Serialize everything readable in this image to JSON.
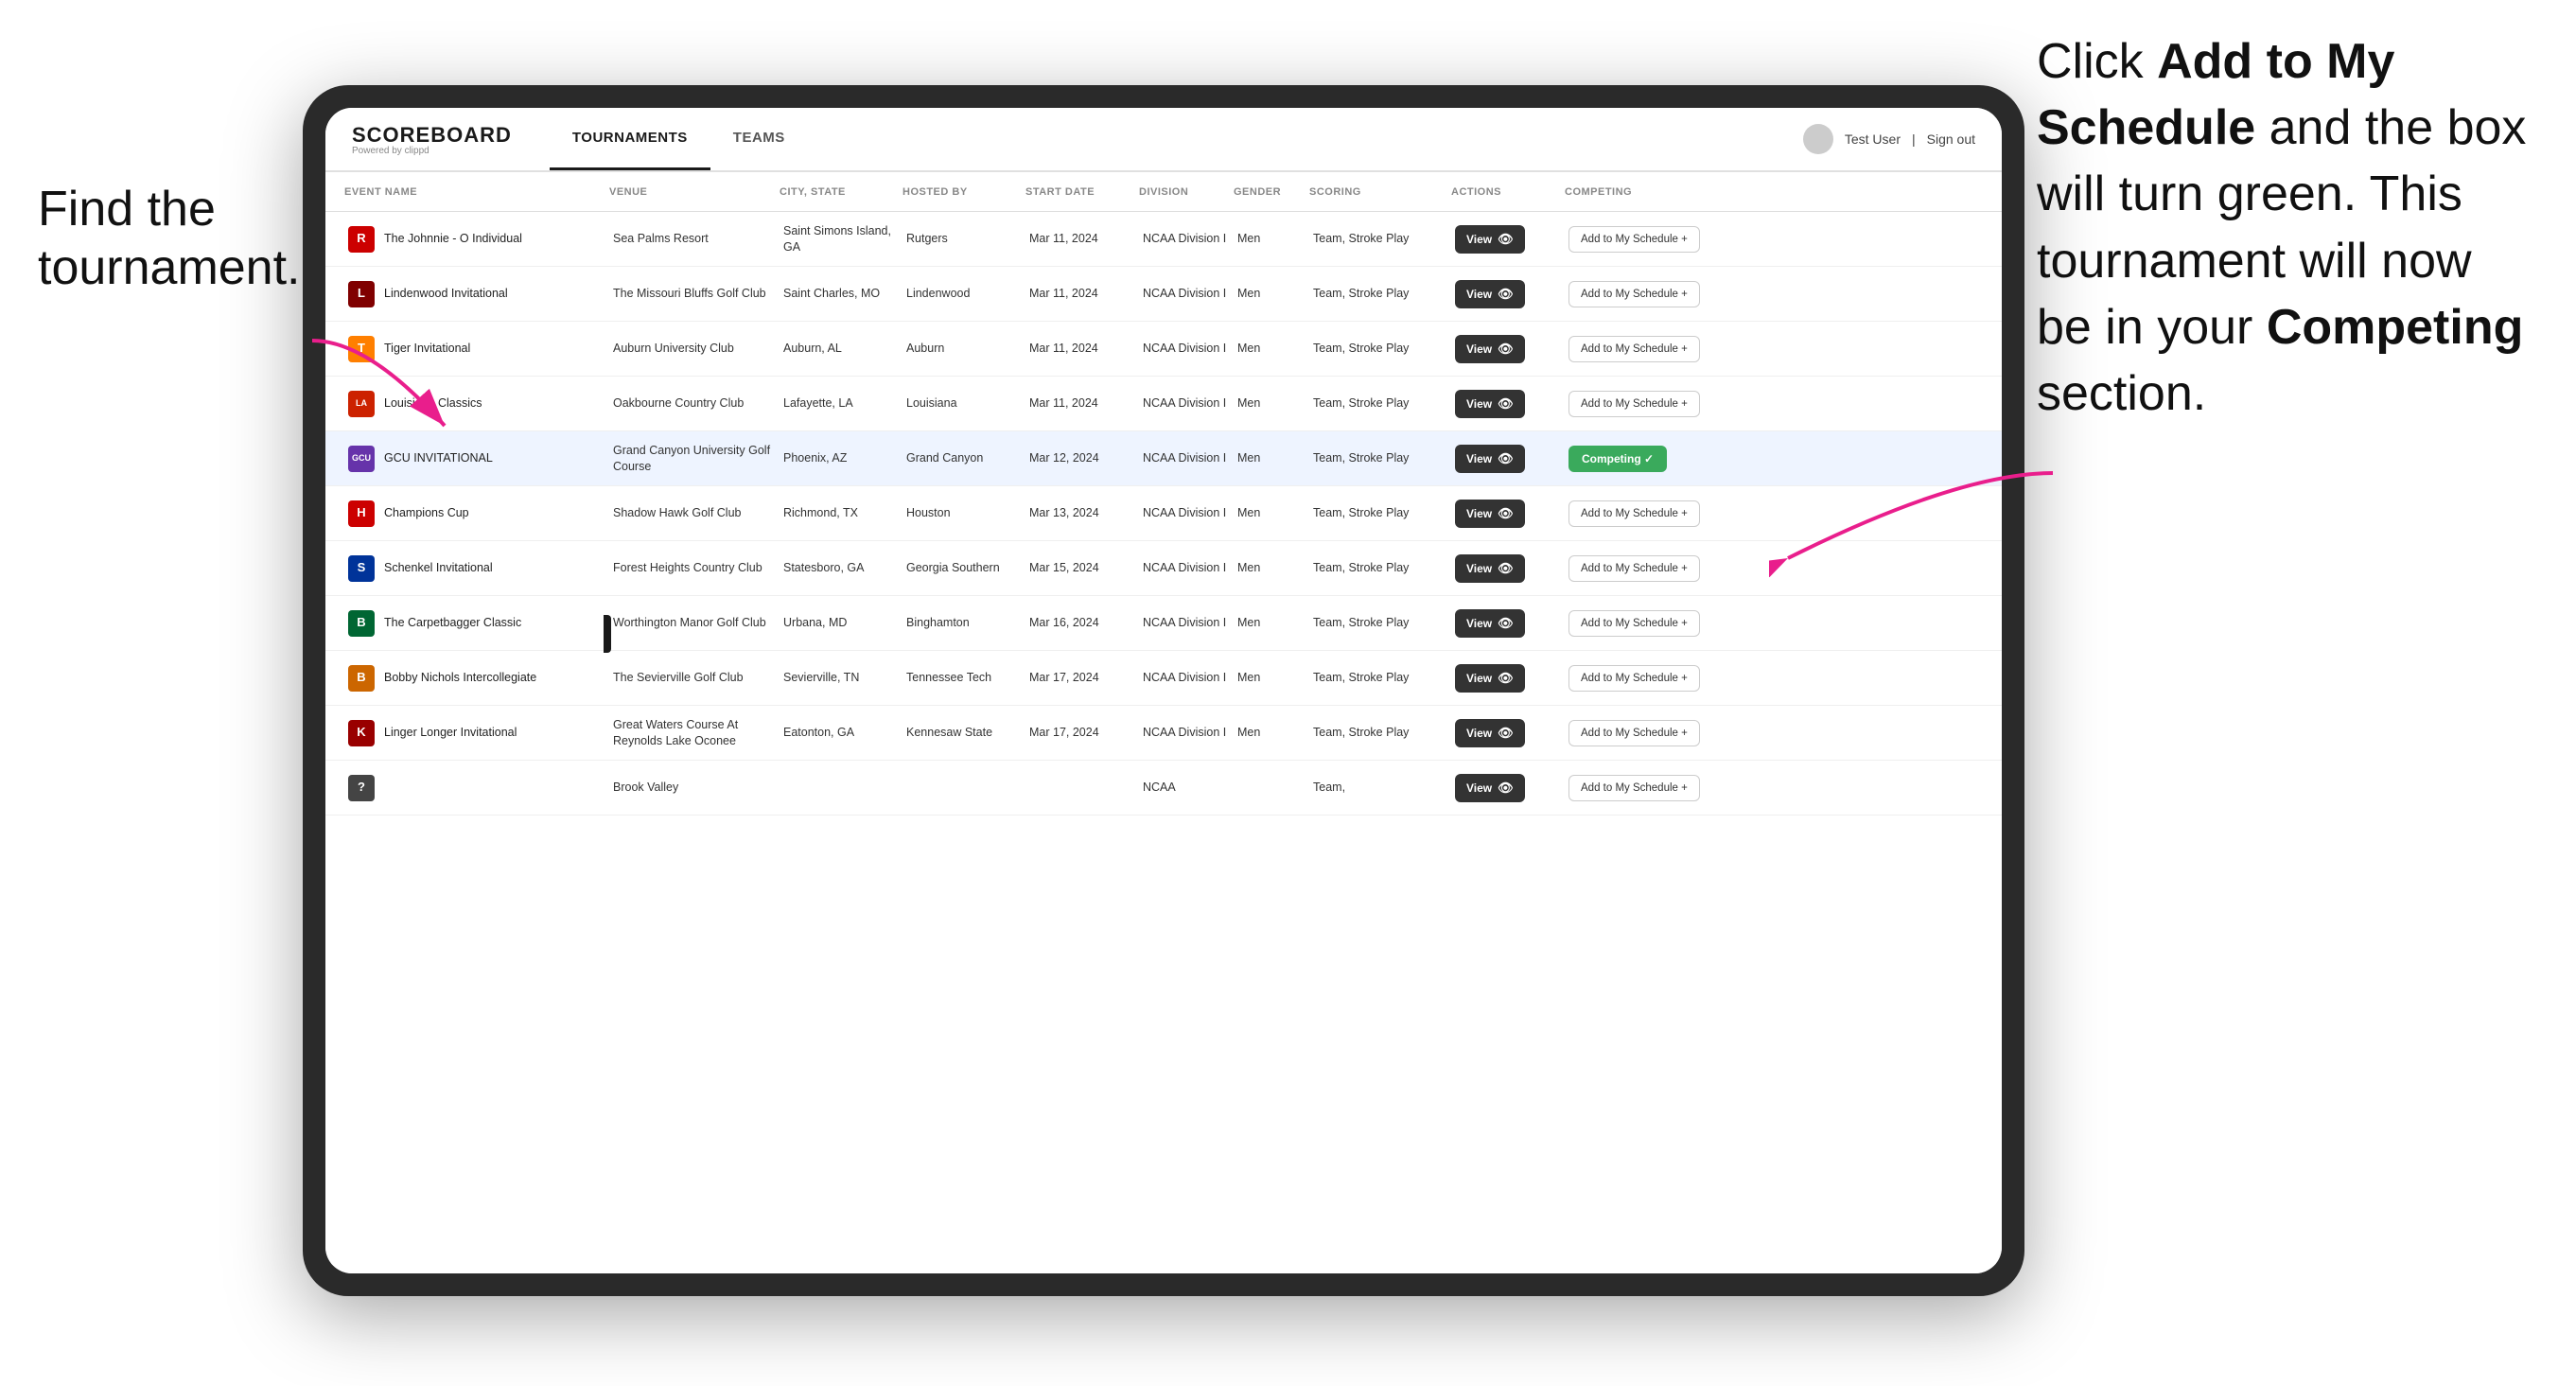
{
  "annotations": {
    "left": "Find the\ntournament.",
    "right_pre": "Click ",
    "right_bold1": "Add to My\nSchedule",
    "right_mid": " and the box will turn green. This tournament will now be in your ",
    "right_bold2": "Competing",
    "right_end": " section."
  },
  "nav": {
    "logo": "SCOREBOARD",
    "logo_sub": "Powered by clippd",
    "tabs": [
      "TOURNAMENTS",
      "TEAMS"
    ],
    "active_tab": "TOURNAMENTS",
    "user": "Test User",
    "signout": "Sign out"
  },
  "table": {
    "headers": [
      "EVENT NAME",
      "VENUE",
      "CITY, STATE",
      "HOSTED BY",
      "START DATE",
      "DIVISION",
      "GENDER",
      "SCORING",
      "ACTIONS",
      "COMPETING"
    ],
    "rows": [
      {
        "logo_color": "#cc0000",
        "logo_letter": "R",
        "name": "The Johnnie - O Individual",
        "venue": "Sea Palms Resort",
        "city": "Saint Simons Island, GA",
        "hosted_by": "Rutgers",
        "start_date": "Mar 11, 2024",
        "division": "NCAA Division I",
        "gender": "Men",
        "scoring": "Team, Stroke Play",
        "action": "View",
        "competing_state": "add",
        "competing_label": "Add to My Schedule +"
      },
      {
        "logo_color": "#800000",
        "logo_letter": "L",
        "name": "Lindenwood Invitational",
        "venue": "The Missouri Bluffs Golf Club",
        "city": "Saint Charles, MO",
        "hosted_by": "Lindenwood",
        "start_date": "Mar 11, 2024",
        "division": "NCAA Division I",
        "gender": "Men",
        "scoring": "Team, Stroke Play",
        "action": "View",
        "competing_state": "add",
        "competing_label": "Add to My Schedule +"
      },
      {
        "logo_color": "#FF7F00",
        "logo_letter": "T",
        "name": "Tiger Invitational",
        "venue": "Auburn University Club",
        "city": "Auburn, AL",
        "hosted_by": "Auburn",
        "start_date": "Mar 11, 2024",
        "division": "NCAA Division I",
        "gender": "Men",
        "scoring": "Team, Stroke Play",
        "action": "View",
        "competing_state": "add",
        "competing_label": "Add to My Schedule +"
      },
      {
        "logo_color": "#cc2200",
        "logo_letter": "LA",
        "name": "Louisiana Classics",
        "venue": "Oakbourne Country Club",
        "city": "Lafayette, LA",
        "hosted_by": "Louisiana",
        "start_date": "Mar 11, 2024",
        "division": "NCAA Division I",
        "gender": "Men",
        "scoring": "Team, Stroke Play",
        "action": "View",
        "competing_state": "add",
        "competing_label": "Add to My Schedule +"
      },
      {
        "logo_color": "#6633aa",
        "logo_letter": "GCU",
        "name": "GCU INVITATIONAL",
        "venue": "Grand Canyon University Golf Course",
        "city": "Phoenix, AZ",
        "hosted_by": "Grand Canyon",
        "start_date": "Mar 12, 2024",
        "division": "NCAA Division I",
        "gender": "Men",
        "scoring": "Team, Stroke Play",
        "action": "View",
        "competing_state": "competing",
        "competing_label": "Competing ✓",
        "highlighted": true
      },
      {
        "logo_color": "#cc0000",
        "logo_letter": "H",
        "name": "Champions Cup",
        "venue": "Shadow Hawk Golf Club",
        "city": "Richmond, TX",
        "hosted_by": "Houston",
        "start_date": "Mar 13, 2024",
        "division": "NCAA Division I",
        "gender": "Men",
        "scoring": "Team, Stroke Play",
        "action": "View",
        "competing_state": "add",
        "competing_label": "Add to My Schedule +"
      },
      {
        "logo_color": "#003399",
        "logo_letter": "S",
        "name": "Schenkel Invitational",
        "venue": "Forest Heights Country Club",
        "city": "Statesboro, GA",
        "hosted_by": "Georgia Southern",
        "start_date": "Mar 15, 2024",
        "division": "NCAA Division I",
        "gender": "Men",
        "scoring": "Team, Stroke Play",
        "action": "View",
        "competing_state": "add",
        "competing_label": "Add to My Schedule +"
      },
      {
        "logo_color": "#006633",
        "logo_letter": "B",
        "name": "The Carpetbagger Classic",
        "venue": "Worthington Manor Golf Club",
        "city": "Urbana, MD",
        "hosted_by": "Binghamton",
        "start_date": "Mar 16, 2024",
        "division": "NCAA Division I",
        "gender": "Men",
        "scoring": "Team, Stroke Play",
        "action": "View",
        "competing_state": "add",
        "competing_label": "Add to My Schedule +"
      },
      {
        "logo_color": "#cc6600",
        "logo_letter": "B",
        "name": "Bobby Nichols Intercollegiate",
        "venue": "The Sevierville Golf Club",
        "city": "Sevierville, TN",
        "hosted_by": "Tennessee Tech",
        "start_date": "Mar 17, 2024",
        "division": "NCAA Division I",
        "gender": "Men",
        "scoring": "Team, Stroke Play",
        "action": "View",
        "competing_state": "add",
        "competing_label": "Add to My Schedule +"
      },
      {
        "logo_color": "#990000",
        "logo_letter": "K",
        "name": "Linger Longer Invitational",
        "venue": "Great Waters Course At Reynolds Lake Oconee",
        "city": "Eatonton, GA",
        "hosted_by": "Kennesaw State",
        "start_date": "Mar 17, 2024",
        "division": "NCAA Division I",
        "gender": "Men",
        "scoring": "Team, Stroke Play",
        "action": "View",
        "competing_state": "add",
        "competing_label": "Add to My Schedule +"
      },
      {
        "logo_color": "#444",
        "logo_letter": "?",
        "name": "",
        "venue": "Brook Valley",
        "city": "",
        "hosted_by": "",
        "start_date": "",
        "division": "NCAA",
        "gender": "",
        "scoring": "Team,",
        "action": "View",
        "competing_state": "add",
        "competing_label": "Add to My Schedule +"
      }
    ]
  },
  "colors": {
    "competing_green": "#3aaa5c",
    "view_btn_dark": "#333333",
    "add_btn_border": "#cccccc"
  }
}
